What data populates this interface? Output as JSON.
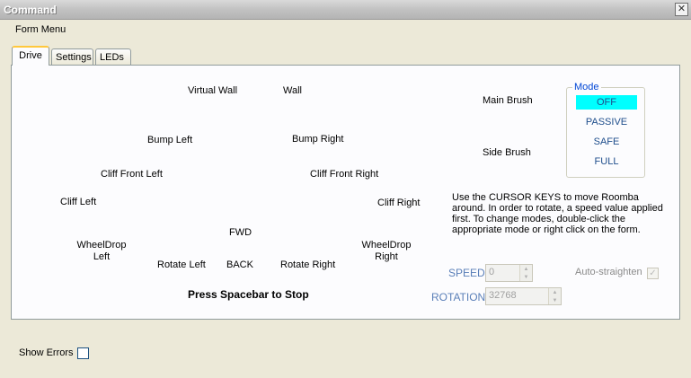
{
  "window": {
    "title": "Command"
  },
  "menu": {
    "form_menu": "Form Menu"
  },
  "tabs": [
    {
      "label": "Drive",
      "active": true
    },
    {
      "label": "Settings",
      "active": false
    },
    {
      "label": "LEDs",
      "active": false
    }
  ],
  "drive": {
    "virtual_wall": "Virtual Wall",
    "wall": "Wall",
    "bump_left": "Bump Left",
    "bump_right": "Bump Right",
    "cliff_front_left": "Cliff Front Left",
    "cliff_front_right": "Cliff Front Right",
    "cliff_left": "Cliff Left",
    "cliff_right": "Cliff Right",
    "fwd": "FWD",
    "wheeldrop_left": "WheelDrop Left",
    "wheeldrop_right": "WheelDrop Right",
    "rotate_left": "Rotate Left",
    "back": "BACK",
    "rotate_right": "Rotate Right",
    "stop_hint": "Press Spacebar to Stop",
    "main_brush": "Main Brush",
    "side_brush": "Side Brush"
  },
  "mode": {
    "legend": "Mode",
    "options": [
      "OFF",
      "PASSIVE",
      "SAFE",
      "FULL"
    ],
    "selected": "OFF",
    "selected_color": "#00ffff"
  },
  "instructions": "Use the CURSOR KEYS to move Roomba around. In order to rotate, a speed value applied first. To change modes, double-click the appropriate mode or right click on the form.",
  "speed": {
    "label": "SPEED:",
    "value": "0"
  },
  "rotation": {
    "label": "ROTATION:",
    "value": "32768"
  },
  "auto_straighten": {
    "label": "Auto-straighten",
    "checked": true
  },
  "show_errors": {
    "label": "Show Errors",
    "checked": false
  },
  "icons": {
    "close": "close-icon",
    "spin_up": "spin-up-icon",
    "spin_down": "spin-down-icon",
    "check": "check-icon"
  }
}
